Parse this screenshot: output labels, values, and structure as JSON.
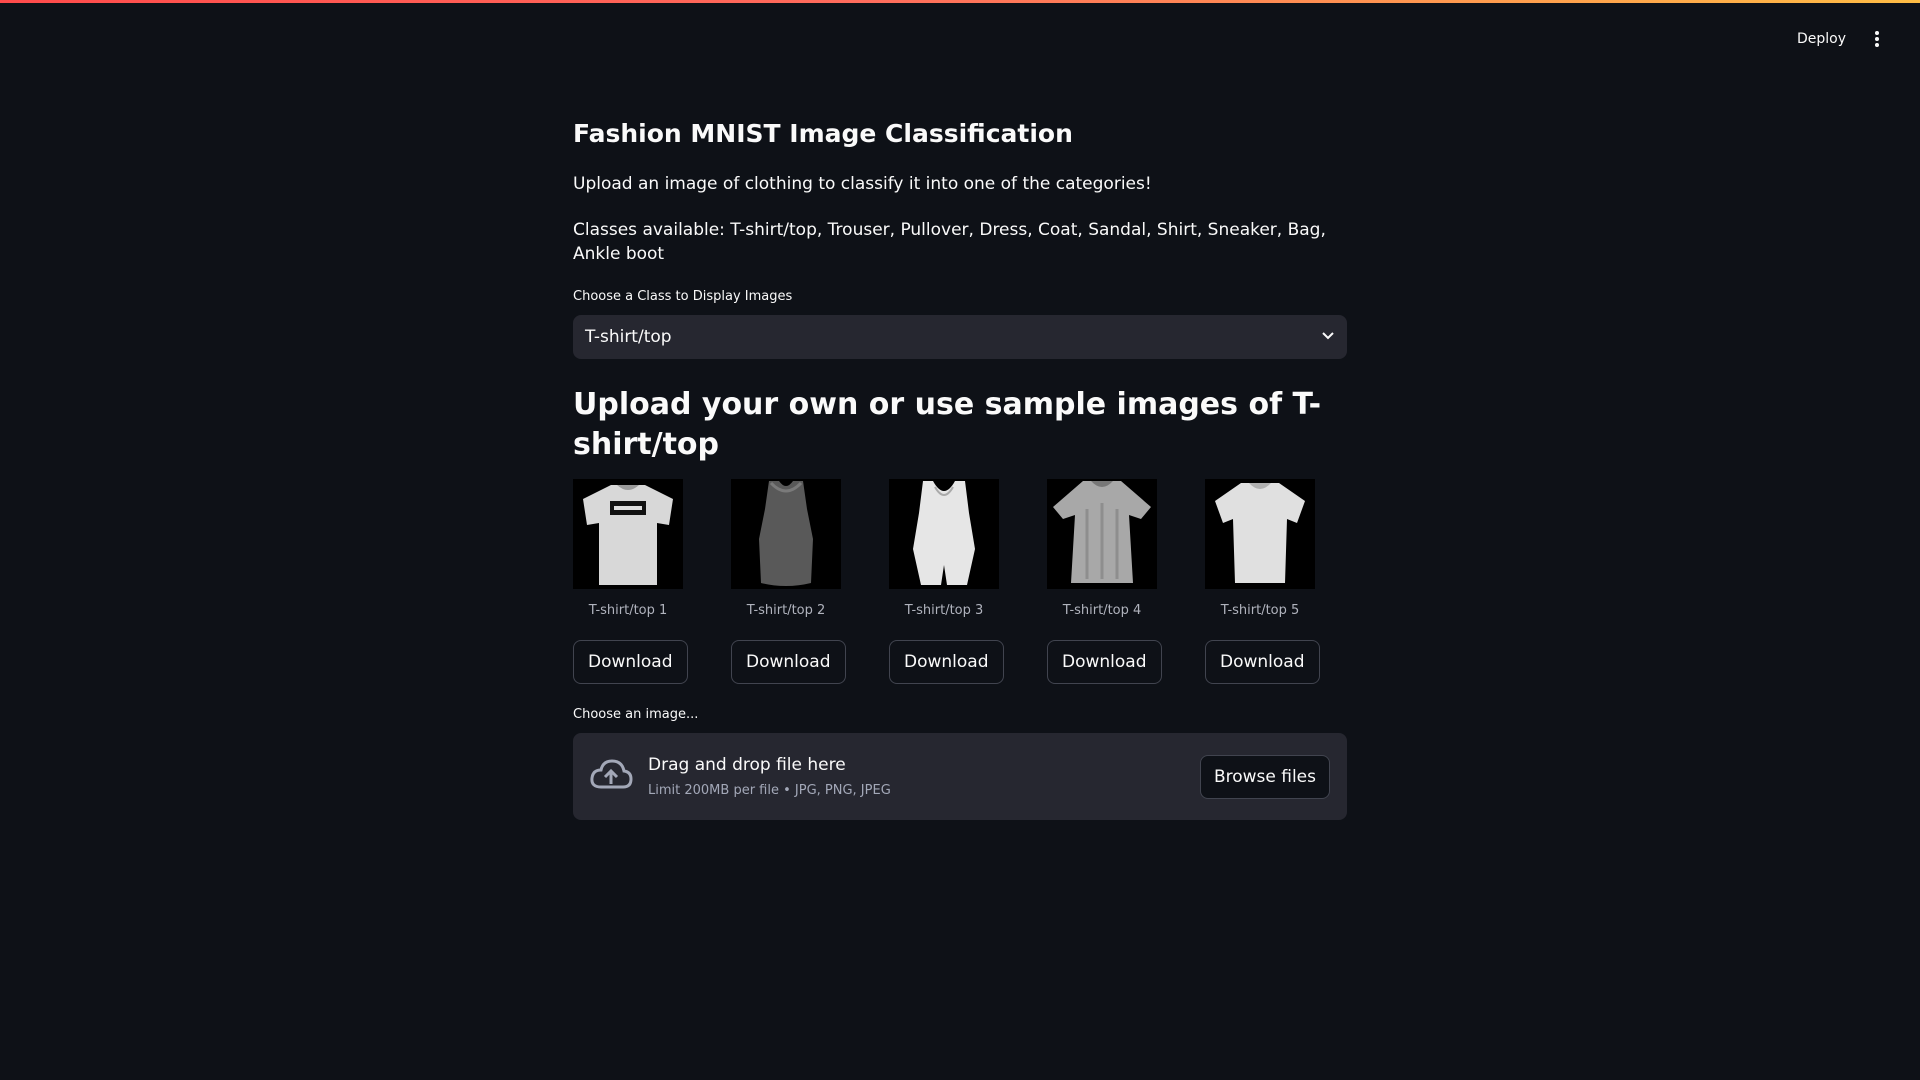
{
  "header": {
    "deploy_label": "Deploy",
    "menu_icon": "vertical-dots-icon",
    "accent_gradient": [
      "#ff4b4b",
      "#ffbd45"
    ]
  },
  "main": {
    "title": "Fashion MNIST Image Classification",
    "intro": "Upload an image of clothing to classify it into one of the categories!",
    "classes_text": "Classes available: T-shirt/top, Trouser, Pullover, Dress, Coat, Sandal, Shirt, Sneaker, Bag, Ankle boot",
    "select": {
      "label": "Choose a Class to Display Images",
      "value": "T-shirt/top",
      "icon": "chevron-down-icon"
    },
    "section_heading": "Upload your own or use sample images of T-shirt/top",
    "samples": [
      {
        "caption": "T-shirt/top 1",
        "download_label": "Download"
      },
      {
        "caption": "T-shirt/top 2",
        "download_label": "Download"
      },
      {
        "caption": "T-shirt/top 3",
        "download_label": "Download"
      },
      {
        "caption": "T-shirt/top 4",
        "download_label": "Download"
      },
      {
        "caption": "T-shirt/top 5",
        "download_label": "Download"
      }
    ],
    "uploader": {
      "label": "Choose an image...",
      "drop_text": "Drag and drop file here",
      "limit_text": "Limit 200MB per file • JPG, PNG, JPEG",
      "browse_label": "Browse files",
      "icon": "cloud-upload-icon"
    }
  },
  "colors": {
    "background": "#0e1117",
    "surface": "#262730",
    "border": "#41444f",
    "text": "#fafafa"
  }
}
